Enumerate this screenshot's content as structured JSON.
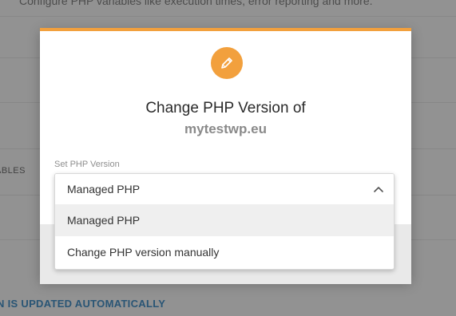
{
  "background": {
    "top_text": "Configure PHP variables like execution times, error reporting and more.",
    "side_label": "ABLES",
    "bottom_label": "N IS UPDATED AUTOMATICALLY"
  },
  "modal": {
    "icon": "pencil-icon",
    "title": "Change PHP Version of",
    "domain": "mytestwp.eu",
    "field_label": "Set PHP Version",
    "accent_color": "#f2a03d"
  },
  "php_select": {
    "selected_value": "Managed PHP",
    "expanded": true,
    "chevron_icon": "chevron-up-icon",
    "options": [
      {
        "label": "Managed PHP",
        "selected": true
      },
      {
        "label": "Change PHP version manually",
        "selected": false
      }
    ]
  }
}
